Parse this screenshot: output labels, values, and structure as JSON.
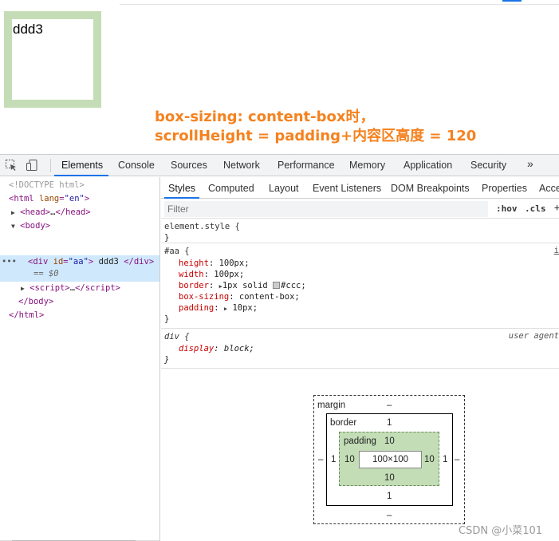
{
  "page": {
    "demo_text": "ddd3",
    "annotation_line1": "box-sizing: content-box时，",
    "annotation_line2": "scrollHeight = padding+内容区高度 = 120"
  },
  "devtools": {
    "tabs": [
      "Elements",
      "Console",
      "Sources",
      "Network",
      "Performance",
      "Memory",
      "Application",
      "Security"
    ],
    "active_tab": "Elements",
    "more_tabs": "»",
    "elements_tree": {
      "doctype": "<!DOCTYPE html>",
      "html_open": "html",
      "html_attr_name": "lang",
      "html_attr_value": "\"en\"",
      "head": "head",
      "head_ellipsis": "…",
      "body": "body",
      "div_tag": "div",
      "div_attr_name": "id",
      "div_attr_value": "\"aa\"",
      "div_text": "ddd3",
      "selected_marker": "== $0",
      "dots": "•••",
      "script": "script",
      "script_ellipsis": "…",
      "body_close": "body",
      "html_close": "html"
    },
    "styles": {
      "subtabs": [
        "Styles",
        "Computed",
        "Layout",
        "Event Listeners",
        "DOM Breakpoints",
        "Properties",
        "Acce"
      ],
      "active_subtab": "Styles",
      "filter_placeholder": "Filter",
      "hov": ":hov",
      "cls": ".cls",
      "plus": "+",
      "element_style": "element.style {",
      "close_brace": "}",
      "aa_selector": "#aa {",
      "aa_source": "i",
      "aa_props": [
        {
          "name": "height",
          "value": "100px;"
        },
        {
          "name": "width",
          "value": "100px;"
        },
        {
          "name": "border",
          "value_pre": "1px solid",
          "value_post": "#ccc;"
        },
        {
          "name": "box-sizing",
          "value": "content-box;"
        },
        {
          "name": "padding",
          "value": "10px;"
        }
      ],
      "div_selector": "div {",
      "div_source": "user agent",
      "div_prop_name": "display",
      "div_prop_value": "block;"
    },
    "box_model": {
      "margin_label": "margin",
      "margin_top": "–",
      "margin_bottom": "–",
      "margin_left": "–",
      "margin_right": "–",
      "border_label": "border",
      "border_top": "1",
      "border_bottom": "1",
      "border_left": "1",
      "border_right": "1",
      "padding_label": "padding",
      "padding_top": "10",
      "padding_bottom": "10",
      "padding_left": "10",
      "padding_right": "10",
      "content": "100×100"
    }
  },
  "watermark": "CSDN @小菜101"
}
